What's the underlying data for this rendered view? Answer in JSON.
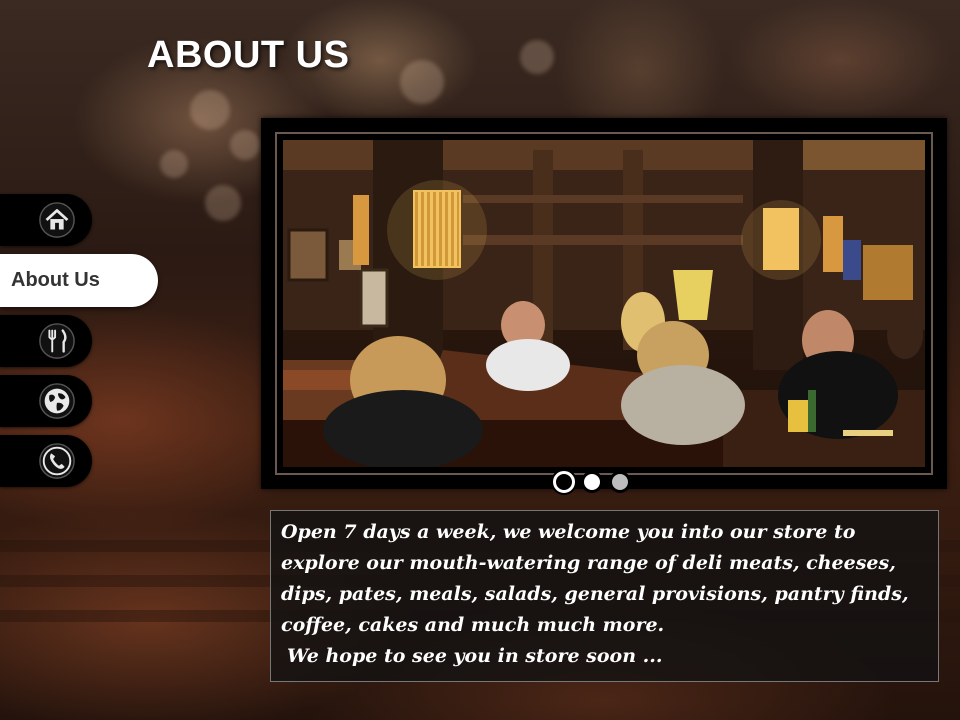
{
  "page": {
    "title": "ABOUT US"
  },
  "nav": {
    "items": [
      {
        "id": "home",
        "icon": "home-icon",
        "label": ""
      },
      {
        "id": "about",
        "icon": "",
        "label": "About Us",
        "active": true
      },
      {
        "id": "menu",
        "icon": "fork-knife-icon",
        "label": ""
      },
      {
        "id": "location",
        "icon": "globe-icon",
        "label": ""
      },
      {
        "id": "contact",
        "icon": "phone-icon",
        "label": ""
      }
    ]
  },
  "gallery": {
    "image": "restaurant-interior-photo",
    "slides": 3,
    "active_slide": 1
  },
  "about": {
    "body": "Open 7 days a week, we welcome you into our store to explore our mouth-watering range of deli meats, cheeses, dips, pates, meals, salads, general provisions, pantry finds, coffee, cakes and much much more.",
    "closing": "We hope to see you in store soon ..."
  },
  "colors": {
    "nav_button": "#000000",
    "nav_active": "#ffffff",
    "text": "#ffffff"
  }
}
